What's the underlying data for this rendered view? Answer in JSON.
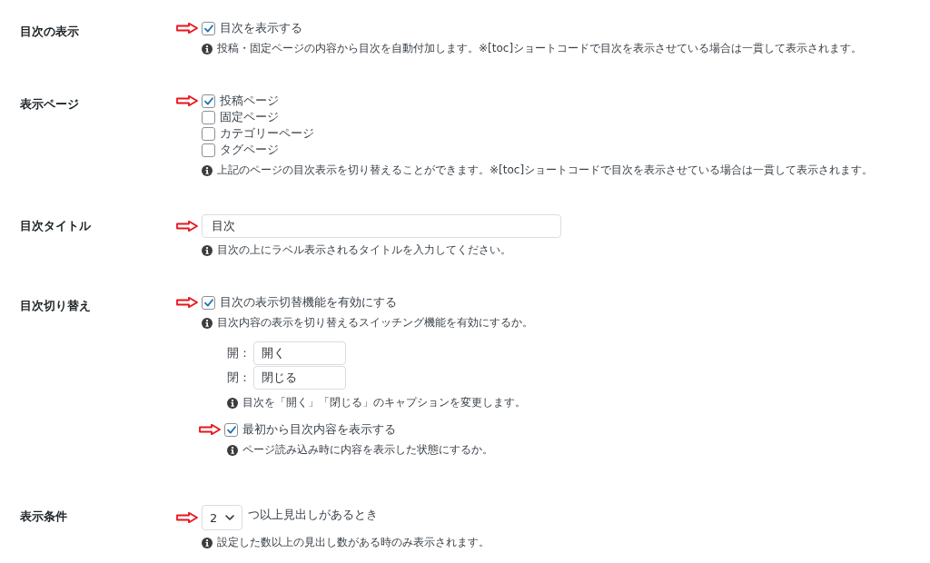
{
  "sections": [
    {
      "label": "目次の表示",
      "items": [
        {
          "kind": "checkbox",
          "label": "目次を表示する",
          "checked": true,
          "arrow": true
        },
        {
          "kind": "note",
          "text": "投稿・固定ページの内容から目次を自動付加します。※[toc]ショートコードで目次を表示させている場合は一貫して表示されます。"
        }
      ]
    },
    {
      "label": "表示ページ",
      "items": [
        {
          "kind": "checkbox",
          "label": "投稿ページ",
          "checked": true,
          "arrow": true
        },
        {
          "kind": "checkbox",
          "label": "固定ページ",
          "checked": false,
          "arrow": false
        },
        {
          "kind": "checkbox",
          "label": "カテゴリーページ",
          "checked": false,
          "arrow": false
        },
        {
          "kind": "checkbox",
          "label": "タグページ",
          "checked": false,
          "arrow": false
        },
        {
          "kind": "note",
          "text": "上記のページの目次表示を切り替えることができます。※[toc]ショートコードで目次を表示させている場合は一貫して表示されます。"
        }
      ]
    },
    {
      "label": "目次タイトル",
      "items": [
        {
          "kind": "text",
          "value": "目次",
          "arrow": true
        },
        {
          "kind": "note",
          "text": "目次の上にラベル表示されるタイトルを入力してください。"
        }
      ]
    },
    {
      "label": "目次切り替え",
      "items": [
        {
          "kind": "checkbox",
          "label": "目次の表示切替機能を有効にする",
          "checked": true,
          "arrow": true
        },
        {
          "kind": "note",
          "text": "目次内容の表示を切り替えるスイッチング機能を有効にするか。"
        },
        {
          "kind": "group",
          "items": [
            {
              "kind": "caption",
              "label": "開：",
              "value": "開く"
            },
            {
              "kind": "caption",
              "label": "閉：",
              "value": "閉じる"
            },
            {
              "kind": "note",
              "text": "目次を「開く」「閉じる」のキャプションを変更します。"
            },
            {
              "kind": "checkbox",
              "label": "最初から目次内容を表示する",
              "checked": true,
              "arrow": true
            },
            {
              "kind": "note",
              "text": "ページ読み込み時に内容を表示した状態にするか。"
            }
          ]
        }
      ]
    },
    {
      "label": "表示条件",
      "items": [
        {
          "kind": "select",
          "value": "2",
          "suffix": "つ以上見出しがあるとき",
          "arrow": true
        },
        {
          "kind": "note",
          "text": "設定した数以上の見出し数がある時のみ表示されます。"
        }
      ]
    }
  ]
}
